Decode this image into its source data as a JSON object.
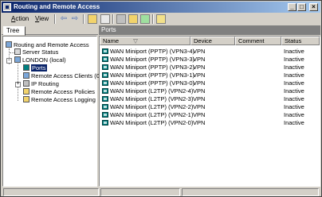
{
  "window": {
    "title": "Routing and Remote Access"
  },
  "titlebar_buttons": {
    "minimize": "_",
    "maximize": "□",
    "close": "×"
  },
  "menu": {
    "action": {
      "hotkey": "A",
      "rest": "ction"
    },
    "view": {
      "hotkey": "V",
      "rest": "iew"
    }
  },
  "toolbar": {
    "back": "⇦",
    "forward": "⇨",
    "tools": [
      "up-folder-icon",
      "show-hide-tree-icon",
      "properties-icon",
      "export-list-icon",
      "refresh-icon",
      "help-icon"
    ]
  },
  "tree": {
    "tab_label": "Tree",
    "root": "Routing and Remote Access",
    "server_status": "Server Status",
    "server": "LONDON (local)",
    "items": {
      "ports": "Ports",
      "remote_access_clients": "Remote Access Clients (0)",
      "ip_routing": "IP Routing",
      "remote_access_policies": "Remote Access Policies",
      "remote_access_logging": "Remote Access Logging"
    },
    "expand_symbols": {
      "collapsed": "+",
      "expanded": "−"
    }
  },
  "right_pane": {
    "title": "Ports",
    "columns": {
      "name": "Name",
      "device": "Device",
      "comment": "Comment",
      "status": "Status"
    },
    "sort_glyph": "▽",
    "rows": [
      {
        "name": "WAN Miniport (PPTP) (VPN3-4)",
        "device": "VPN",
        "comment": "",
        "status": "Inactive"
      },
      {
        "name": "WAN Miniport (PPTP) (VPN3-3)",
        "device": "VPN",
        "comment": "",
        "status": "Inactive"
      },
      {
        "name": "WAN Miniport (PPTP) (VPN3-2)",
        "device": "VPN",
        "comment": "",
        "status": "Inactive"
      },
      {
        "name": "WAN Miniport (PPTP) (VPN3-1)",
        "device": "VPN",
        "comment": "",
        "status": "Inactive"
      },
      {
        "name": "WAN Miniport (PPTP) (VPN3-0)",
        "device": "VPN",
        "comment": "",
        "status": "Inactive"
      },
      {
        "name": "WAN Miniport (L2TP) (VPN2-4)",
        "device": "VPN",
        "comment": "",
        "status": "Inactive"
      },
      {
        "name": "WAN Miniport (L2TP) (VPN2-3)",
        "device": "VPN",
        "comment": "",
        "status": "Inactive"
      },
      {
        "name": "WAN Miniport (L2TP) (VPN2-2)",
        "device": "VPN",
        "comment": "",
        "status": "Inactive"
      },
      {
        "name": "WAN Miniport (L2TP) (VPN2-1)",
        "device": "VPN",
        "comment": "",
        "status": "Inactive"
      },
      {
        "name": "WAN Miniport (L2TP) (VPN2-0)",
        "device": "VPN",
        "comment": "",
        "status": "Inactive"
      }
    ]
  },
  "colors": {
    "title_active": "#0a246a",
    "title_gradient_end": "#a6caf0",
    "face": "#d4d0c8",
    "selection": "#0a246a"
  }
}
